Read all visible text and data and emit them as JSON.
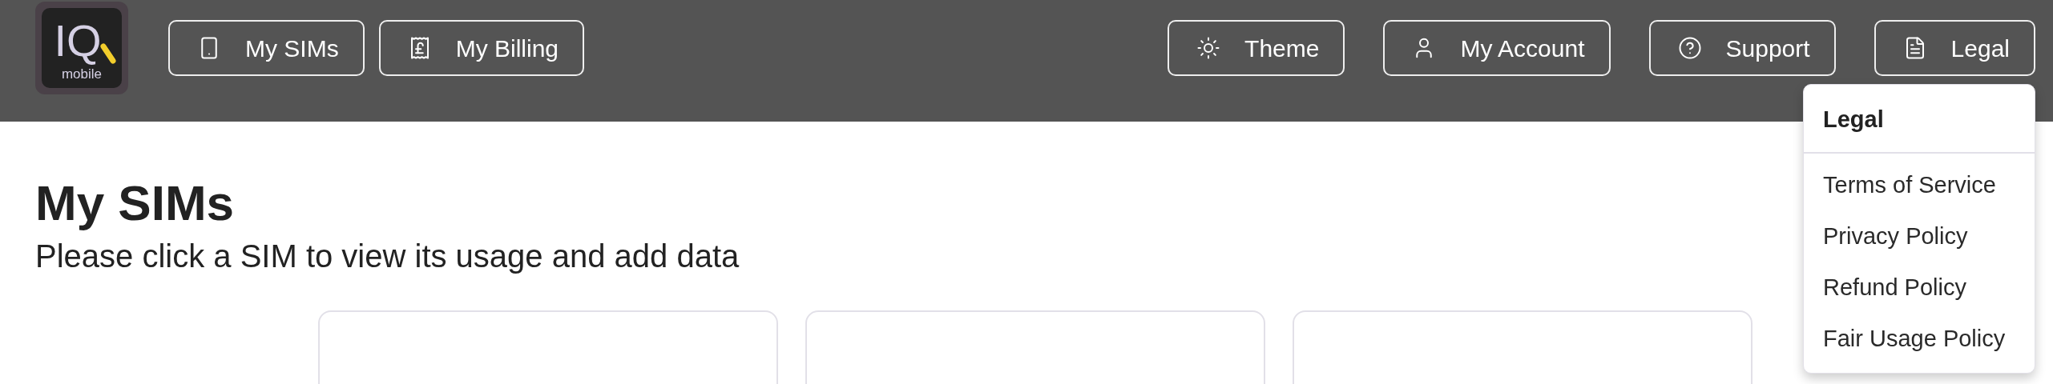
{
  "logo": {
    "mark": "IQ",
    "caption": "mobile"
  },
  "nav_left": [
    {
      "label": "My SIMs"
    },
    {
      "label": "My Billing"
    }
  ],
  "nav_right": [
    {
      "label": "Theme"
    },
    {
      "label": "My Account"
    },
    {
      "label": "Support"
    },
    {
      "label": "Legal",
      "menu": {
        "title": "Legal",
        "items": [
          "Terms of Service",
          "Privacy Policy",
          "Refund Policy",
          "Fair Usage Policy"
        ]
      }
    }
  ],
  "page": {
    "title": "My SIMs",
    "subtitle": "Please click a SIM to view its usage and add data"
  },
  "sim_cards": [
    {
      "kind": "card"
    },
    {
      "kind": "card"
    },
    {
      "kind": "card"
    }
  ]
}
